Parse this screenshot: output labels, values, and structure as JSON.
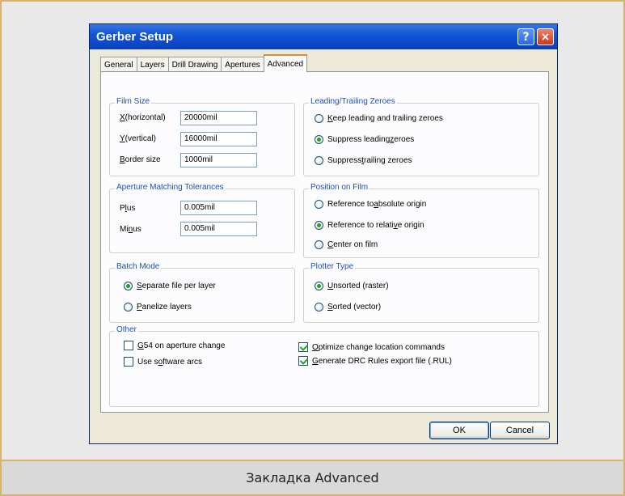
{
  "window": {
    "title": "Gerber Setup",
    "help_glyph": "?",
    "close_glyph": "×"
  },
  "tabs": [
    {
      "label": "General",
      "active": false
    },
    {
      "label": "Layers",
      "active": false
    },
    {
      "label": "Drill Drawing",
      "active": false
    },
    {
      "label": "Apertures",
      "active": false
    },
    {
      "label": "Advanced",
      "active": true
    }
  ],
  "film_size": {
    "legend": "Film Size",
    "horizontal": {
      "label_u": "X",
      "label_rest": " (horizontal)",
      "value": "20000mil"
    },
    "vertical": {
      "label_u": "Y",
      "label_rest": " (vertical)",
      "value": "16000mil"
    },
    "border": {
      "label_u": "B",
      "label_rest": "order size",
      "value": "1000mil"
    }
  },
  "aperture_tolerances": {
    "legend": "Aperture Matching Tolerances",
    "plus": {
      "label_pre": "P",
      "label_u": "l",
      "label_rest": "us",
      "value": "0.005mil"
    },
    "minus": {
      "label_pre": "Mi",
      "label_u": "n",
      "label_rest": "us",
      "value": "0.005mil"
    }
  },
  "batch_mode": {
    "legend": "Batch Mode",
    "options": [
      {
        "pre": "",
        "u": "S",
        "rest": "eparate file per layer",
        "selected": true
      },
      {
        "pre": "",
        "u": "P",
        "rest": "anelize layers",
        "selected": false
      }
    ]
  },
  "zeroes": {
    "legend": "Leading/Trailing Zeroes",
    "options": [
      {
        "pre": "",
        "u": "K",
        "rest": "eep leading and trailing zeroes",
        "selected": false
      },
      {
        "pre": "Suppress leading ",
        "u": "z",
        "rest": "eroes",
        "selected": true
      },
      {
        "pre": "Suppress ",
        "u": "t",
        "rest": "railing zeroes",
        "selected": false
      }
    ]
  },
  "position": {
    "legend": "Position on Film",
    "options": [
      {
        "pre": "Reference to ",
        "u": "a",
        "rest": "bsolute origin",
        "selected": false
      },
      {
        "pre": "Reference to relati",
        "u": "v",
        "rest": "e origin",
        "selected": true
      },
      {
        "pre": "",
        "u": "C",
        "rest": "enter on film",
        "selected": false
      }
    ]
  },
  "plotter": {
    "legend": "Plotter Type",
    "options": [
      {
        "pre": "",
        "u": "U",
        "rest": "nsorted (raster)",
        "selected": true
      },
      {
        "pre": "",
        "u": "S",
        "rest": "orted (vector)",
        "selected": false
      }
    ]
  },
  "other": {
    "legend": "Other",
    "checks": [
      {
        "pre": "",
        "u": "G",
        "rest": "54 on aperture change",
        "checked": false
      },
      {
        "pre": "Use s",
        "u": "o",
        "rest": "ftware arcs",
        "checked": false
      },
      {
        "pre": "",
        "u": "O",
        "rest": "ptimize change location commands",
        "checked": true
      },
      {
        "pre": "",
        "u": "G",
        "rest": "enerate DRC Rules export file (.RUL)",
        "checked": true
      }
    ]
  },
  "buttons": {
    "ok": "OK",
    "cancel": "Cancel"
  },
  "caption": "Закладка Advanced"
}
